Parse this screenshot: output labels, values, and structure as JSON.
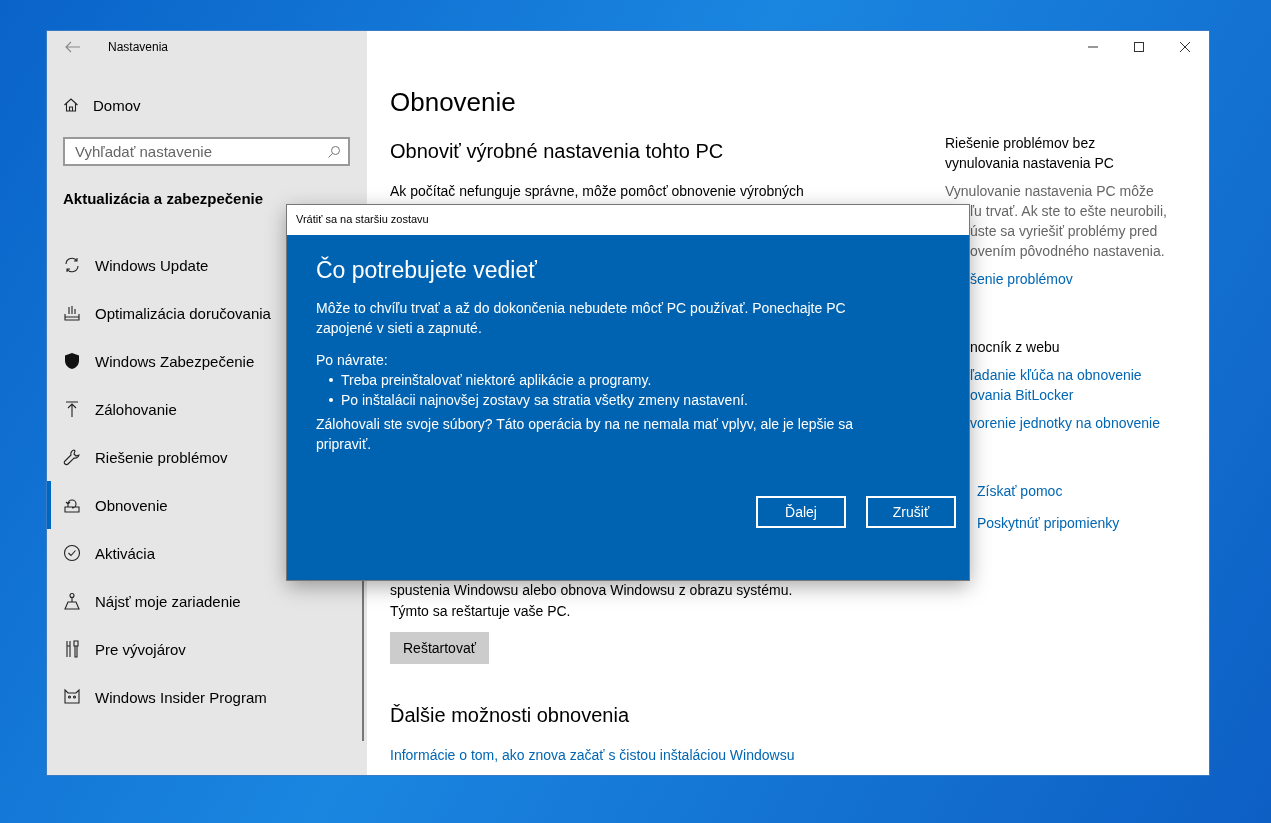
{
  "window": {
    "title": "Nastavenia"
  },
  "sidebar": {
    "home": "Domov",
    "search": {
      "placeholder": "Vyhľadať nastavenie"
    },
    "section": "Aktualizácia a zabezpečenie",
    "items": [
      {
        "label": "Windows Update",
        "selected": false
      },
      {
        "label": "Optimalizácia doručovania",
        "selected": false
      },
      {
        "label": "Windows Zabezpečenie",
        "selected": false
      },
      {
        "label": "Zálohovanie",
        "selected": false
      },
      {
        "label": "Riešenie problémov",
        "selected": false
      },
      {
        "label": "Obnovenie",
        "selected": true
      },
      {
        "label": "Aktivácia",
        "selected": false
      },
      {
        "label": "Nájsť moje zariadenie",
        "selected": false
      },
      {
        "label": "Pre vývojárov",
        "selected": false
      },
      {
        "label": "Windows Insider Program",
        "selected": false
      }
    ]
  },
  "main": {
    "title": "Obnovenie",
    "reset_heading": "Obnoviť výrobné nastavenia tohto PC",
    "reset_text": "Ak počítač nefunguje správne, môže pomôcť obnovenie výrobných",
    "advanced_text": "spustenia Windowsu alebo obnova Windowsu z obrazu systému.",
    "restart_note": "Týmto sa reštartuje vaše PC.",
    "restart_button": "Reštartovať",
    "more_heading": "Ďalšie možnosti obnovenia",
    "more_link": "Informácie o tom, ako znova začať s čistou inštaláciou Windowsu"
  },
  "right_panel": {
    "troubleshoot_title": "Riešenie problémov bez vynulovania nastavenia PC",
    "troubleshoot_first_line": "Vynulovanie nastavenia PC môže",
    "troubleshoot_visible_lines": [
      "ľu trvať. Ak ste to ešte neurobili,",
      "úste sa vyriešiť problémy pred",
      "ovením pôvodného nastavenia."
    ],
    "troubleshoot_link": "šenie problémov",
    "web_help_title": "nocník z webu",
    "web_help_links": [
      "ľadanie kľúča na obnovenie",
      "ovania BitLocker",
      "vorenie jednotky na obnovenie"
    ],
    "support_links": [
      "Získať pomoc",
      "Poskytnúť pripomienky"
    ]
  },
  "dialog": {
    "title": "Vrátiť sa na staršiu zostavu",
    "heading": "Čo potrebujete vedieť",
    "intro": "Môže to chvíľu trvať a až do dokončenia nebudete môcť PC používať. Ponechajte PC zapojené v sieti a zapnuté.",
    "after_label": "Po návrate:",
    "bullets": [
      "Treba preinštalovať niektoré aplikácie a programy.",
      "Po inštalácii najnovšej zostavy sa stratia všetky zmeny nastavení."
    ],
    "backup_note": "Zálohovali ste svoje súbory? Táto operácia by na ne nemala mať vplyv, ale je lepšie sa pripraviť.",
    "buttons": [
      "Ďalej",
      "Zrušiť"
    ]
  }
}
